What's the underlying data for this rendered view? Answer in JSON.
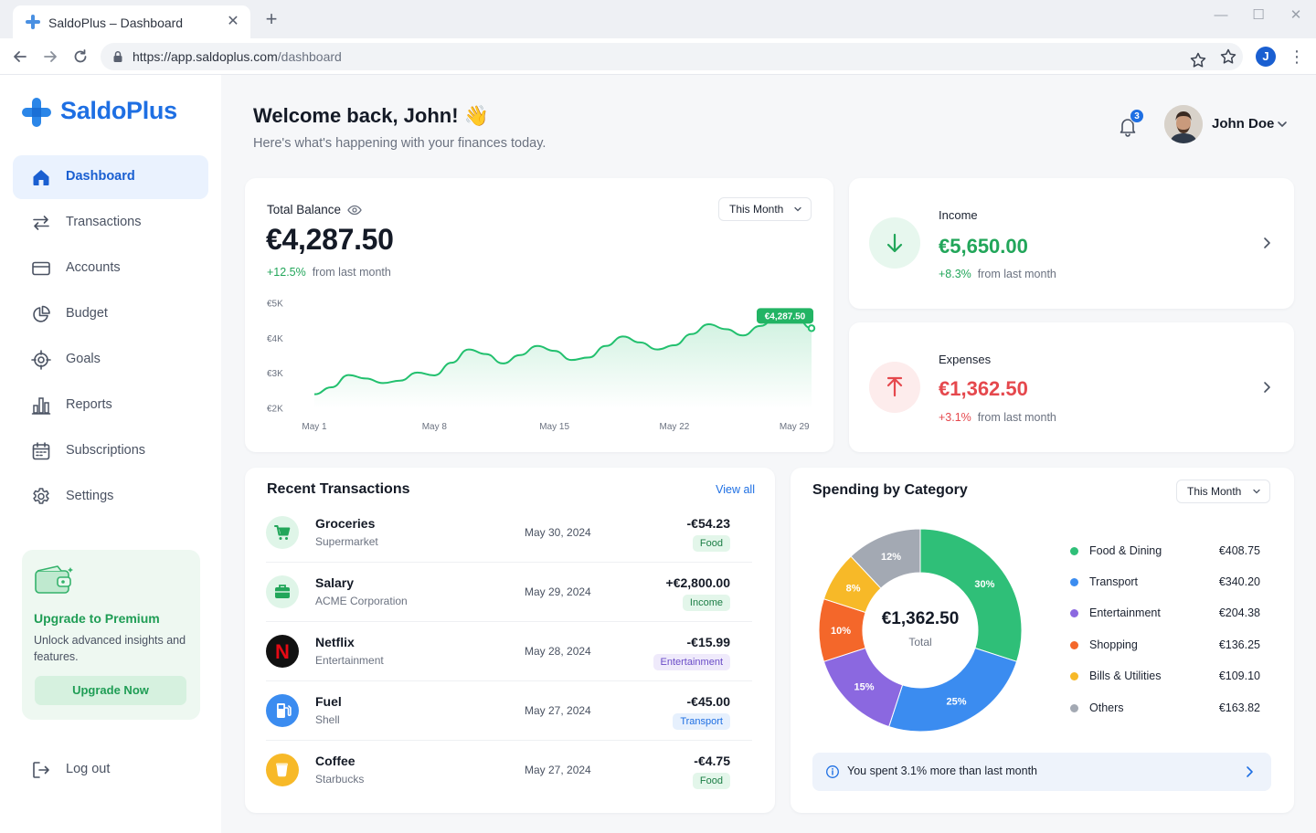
{
  "browser": {
    "tab_title": "SaldoPlus – Dashboard",
    "url_host": "https://app.saldoplus.com",
    "url_path": "/dashboard",
    "profile_initial": "J"
  },
  "brand": {
    "name": "SaldoPlus",
    "color": "#1e6fe3"
  },
  "sidebar": {
    "items": [
      {
        "label": "Dashboard",
        "icon": "home-icon",
        "active": true
      },
      {
        "label": "Transactions",
        "icon": "swap-arrows-icon"
      },
      {
        "label": "Accounts",
        "icon": "credit-card-icon"
      },
      {
        "label": "Budget",
        "icon": "pie-chart-icon"
      },
      {
        "label": "Goals",
        "icon": "target-icon"
      },
      {
        "label": "Reports",
        "icon": "bar-chart-icon"
      },
      {
        "label": "Subscriptions",
        "icon": "calendar-icon"
      },
      {
        "label": "Settings",
        "icon": "gear-icon"
      }
    ],
    "promo": {
      "title": "Upgrade to Premium",
      "text": "Unlock advanced insights and features.",
      "button": "Upgrade Now"
    },
    "logout": "Log out"
  },
  "header": {
    "greeting": "Welcome back, John! 👋",
    "subtitle": "Here's what's happening with your finances today.",
    "notifications": "3",
    "user_name": "John Doe"
  },
  "balance": {
    "label": "Total Balance",
    "period": "This Month",
    "amount": "€4,287.50",
    "change": "+12.5%",
    "change_suffix": "from last month"
  },
  "chart_data": {
    "type": "area",
    "y_tick_labels": [
      "€5K",
      "€4K",
      "€3K",
      "€2K"
    ],
    "y_ticks": [
      5000,
      4000,
      3000,
      2000
    ],
    "ylim": [
      2000,
      5000
    ],
    "x_tick_labels": [
      "May 1",
      "May 8",
      "May 15",
      "May 22",
      "May 29"
    ],
    "x_ticks": [
      1,
      8,
      15,
      22,
      29
    ],
    "xlim": [
      1,
      30
    ],
    "x": [
      1,
      2,
      3,
      4,
      5,
      6,
      7,
      8,
      9,
      10,
      11,
      12,
      13,
      14,
      15,
      16,
      17,
      18,
      19,
      20,
      21,
      22,
      23,
      24,
      25,
      26,
      27,
      28,
      29,
      30
    ],
    "y": [
      2400,
      2600,
      2950,
      2850,
      2720,
      2790,
      3020,
      2940,
      3300,
      3680,
      3550,
      3280,
      3520,
      3780,
      3640,
      3380,
      3450,
      3780,
      4050,
      3880,
      3680,
      3800,
      4120,
      4400,
      4260,
      4080,
      4350,
      4620,
      4650,
      4287.5
    ],
    "end_label": "€4,287.50",
    "series_color": "#22c06e"
  },
  "income": {
    "label": "Income",
    "amount": "€5,650.00",
    "change": "+8.3%",
    "change_suffix": "from last month"
  },
  "expenses": {
    "label": "Expenses",
    "amount": "€1,362.50",
    "change": "+3.1%",
    "change_suffix": "from last month"
  },
  "transactions": {
    "title": "Recent Transactions",
    "view_all": "View all",
    "rows": [
      {
        "name": "Groceries",
        "sub": "Supermarket",
        "date": "May 30, 2024",
        "amount": "-€54.23",
        "tag": "Food",
        "icon": "cart-icon"
      },
      {
        "name": "Salary",
        "sub": "ACME Corporation",
        "date": "May 29, 2024",
        "amount": "+€2,800.00",
        "tag": "Income",
        "icon": "briefcase-icon"
      },
      {
        "name": "Netflix",
        "sub": "Entertainment",
        "date": "May 28, 2024",
        "amount": "-€15.99",
        "tag": "Entertainment",
        "icon": "netflix-logo-icon",
        "logo_text": "N"
      },
      {
        "name": "Fuel",
        "sub": "Shell",
        "date": "May 27, 2024",
        "amount": "-€45.00",
        "tag": "Transport",
        "icon": "fuel-pump-icon"
      },
      {
        "name": "Coffee",
        "sub": "Starbucks",
        "date": "May 27, 2024",
        "amount": "-€4.75",
        "tag": "Food",
        "icon": "coffee-cup-icon"
      }
    ]
  },
  "spending": {
    "title": "Spending by Category",
    "period": "This Month",
    "total": "€1,362.50",
    "total_label": "Total",
    "categories": [
      {
        "name": "Food & Dining",
        "value": "€408.75",
        "pct": 30,
        "pct_label": "30%",
        "color": "#2fbf78"
      },
      {
        "name": "Transport",
        "value": "€340.20",
        "pct": 25,
        "pct_label": "25%",
        "color": "#3b8cf0"
      },
      {
        "name": "Entertainment",
        "value": "€204.38",
        "pct": 15,
        "pct_label": "15%",
        "color": "#8b68e0"
      },
      {
        "name": "Shopping",
        "value": "€136.25",
        "pct": 10,
        "pct_label": "10%",
        "color": "#f4672a"
      },
      {
        "name": "Bills & Utilities",
        "value": "€109.10",
        "pct": 8,
        "pct_label": "8%",
        "color": "#f7b928"
      },
      {
        "name": "Others",
        "value": "€163.82",
        "pct": 12,
        "pct_label": "12%",
        "color": "#a3a9b3"
      }
    ],
    "insight": "You spent 3.1% more than last month"
  }
}
